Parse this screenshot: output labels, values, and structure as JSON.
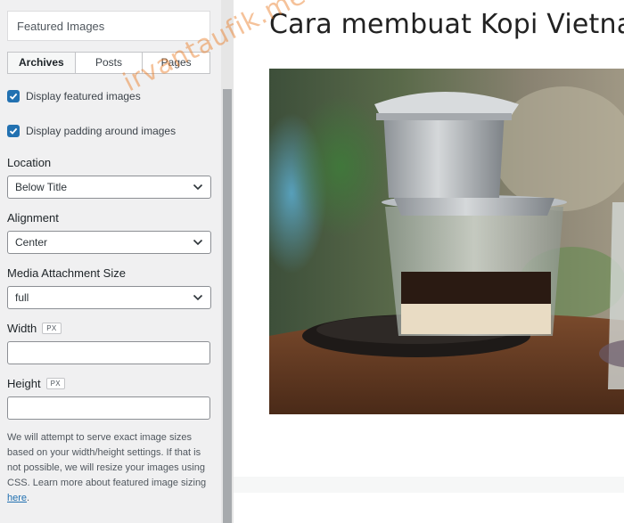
{
  "panel": {
    "section_title": "Featured Images",
    "tabs": [
      {
        "label": "Archives",
        "active": true
      },
      {
        "label": "Posts",
        "active": false
      },
      {
        "label": "Pages",
        "active": false
      }
    ],
    "options": [
      {
        "label": "Display featured images",
        "checked": true
      },
      {
        "label": "Display padding around images",
        "checked": true
      }
    ],
    "location": {
      "label": "Location",
      "value": "Below Title"
    },
    "alignment": {
      "label": "Alignment",
      "value": "Center"
    },
    "media_size": {
      "label": "Media Attachment Size",
      "value": "full"
    },
    "width": {
      "label": "Width",
      "unit": "PX",
      "value": ""
    },
    "height": {
      "label": "Height",
      "unit": "PX",
      "value": ""
    },
    "help_text": "We will attempt to serve exact image sizes based on your width/height settings. If that is not possible, we will resize your images using CSS. Learn more about featured image sizing ",
    "help_link": "here",
    "help_end": "."
  },
  "preview": {
    "post_title": "Cara membuat Kopi Vietnam"
  },
  "watermark": "irvantaufik.me",
  "colors": {
    "accent": "#2271b1",
    "panel_bg": "#f0f0f1",
    "watermark": "#e8781e"
  }
}
